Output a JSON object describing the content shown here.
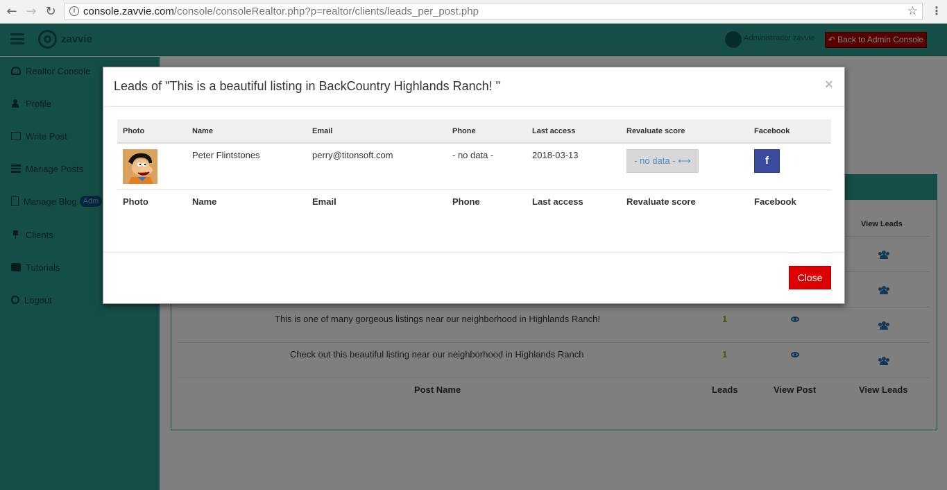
{
  "browser": {
    "url_host": "console.zavvie.com",
    "url_path": "/console/consoleRealtor.php?p=realtor/clients/leads_per_post.php"
  },
  "header": {
    "logo_text": "zavvie",
    "user_name": "Administrador zavvie",
    "back_button": "Back to Admin Console"
  },
  "sidebar": {
    "items": [
      {
        "label": "Realtor Console"
      },
      {
        "label": "Profile"
      },
      {
        "label": "Write Post"
      },
      {
        "label": "Manage Posts"
      },
      {
        "label": "Manage Blog",
        "badge": "Adm"
      },
      {
        "label": "Clients"
      },
      {
        "label": "Tutorials"
      },
      {
        "label": "Logout"
      }
    ]
  },
  "background_table": {
    "header_view_leads": "View Leads",
    "rows": [
      {
        "post": "This is one of many gorgeous listings near our neighborhood in Highlands Ranch!",
        "leads": "1"
      },
      {
        "post": "Check out this beautiful listing near our neighborhood in Highlands Ranch",
        "leads": "1"
      }
    ],
    "footer": {
      "post_name": "Post Name",
      "leads": "Leads",
      "view_post": "View Post",
      "view_leads": "View Leads"
    }
  },
  "modal": {
    "title": "Leads of \"This is a beautiful listing in BackCountry Highlands Ranch! \"",
    "close_x": "×",
    "columns": [
      "Photo",
      "Name",
      "Email",
      "Phone",
      "Last access",
      "Revaluate score",
      "Facebook"
    ],
    "lead": {
      "name": "Peter Flintstones",
      "email": "perry@titonsoft.com",
      "phone": "- no data -",
      "last_access": "2018-03-13",
      "score": "- no data - ⟷",
      "facebook": "f"
    },
    "close_button": "Close"
  },
  "colors": {
    "brand": "#2a9d8f",
    "danger": "#dd0000",
    "facebook": "#3b4ba0",
    "lead_count": "#7ab800"
  }
}
